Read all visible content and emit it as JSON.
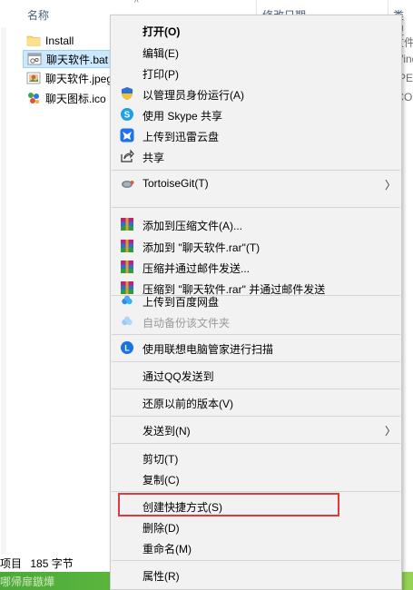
{
  "explorer": {
    "columns": {
      "name": "名称",
      "date": "修改日期",
      "type": "类型"
    },
    "files": [
      {
        "name": "Install",
        "icon": "folder-icon",
        "type_cut": "文件"
      },
      {
        "name": "聊天软件.bat",
        "icon": "bat-file-icon",
        "type_cut": "Wind"
      },
      {
        "name": "聊天软件.jpeg",
        "icon": "jpeg-file-icon",
        "type_cut": "JPEG"
      },
      {
        "name": "聊天图标.ico",
        "icon": "ico-file-icon",
        "type_cut": "ICO"
      }
    ],
    "status": {
      "items_fragment": "项目",
      "size": "185 字节"
    },
    "taskbar_fragment": "哪帰扉鏃燁"
  },
  "menu": {
    "items": [
      {
        "label": "打开(O)",
        "bold": true,
        "icon": ""
      },
      {
        "label": "编辑(E)",
        "icon": ""
      },
      {
        "label": "打印(P)",
        "icon": ""
      },
      {
        "label": "以管理员身份运行(A)",
        "icon": "uac-shield-icon"
      },
      {
        "label": "使用 Skype 共享",
        "icon": "skype-icon"
      },
      {
        "label": "上传到迅雷云盘",
        "icon": "xunlei-icon"
      },
      {
        "label": "共享",
        "icon": "share-icon"
      },
      {
        "label": "TortoiseGit(T)",
        "icon": "tortoisegit-icon",
        "submenu": true
      },
      {
        "label": "添加到压缩文件(A)...",
        "icon": "winrar-icon"
      },
      {
        "label": "添加到 \"聊天软件.rar\"(T)",
        "icon": "winrar-icon"
      },
      {
        "label": "压缩并通过邮件发送...",
        "icon": "winrar-icon"
      },
      {
        "label": "压缩到 \"聊天软件.rar\" 并通过邮件发送",
        "icon": "winrar-icon"
      },
      {
        "label": "上传到百度网盘",
        "icon": "baidu-netdisk-icon"
      },
      {
        "label": "自动备份该文件夹",
        "icon": "baidu-netdisk-icon",
        "disabled": true
      },
      {
        "label": "使用联想电脑管家进行扫描",
        "icon": "lenovo-icon"
      },
      {
        "label": "通过QQ发送到",
        "icon": ""
      },
      {
        "label": "还原以前的版本(V)",
        "icon": ""
      },
      {
        "label": "发送到(N)",
        "icon": "",
        "submenu": true
      },
      {
        "label": "剪切(T)",
        "icon": ""
      },
      {
        "label": "复制(C)",
        "icon": ""
      },
      {
        "label": "创建快捷方式(S)",
        "icon": "",
        "highlighted": true
      },
      {
        "label": "删除(D)",
        "icon": ""
      },
      {
        "label": "重命名(M)",
        "icon": ""
      },
      {
        "label": "属性(R)",
        "icon": ""
      }
    ],
    "highlight_color": "#e0393e"
  }
}
